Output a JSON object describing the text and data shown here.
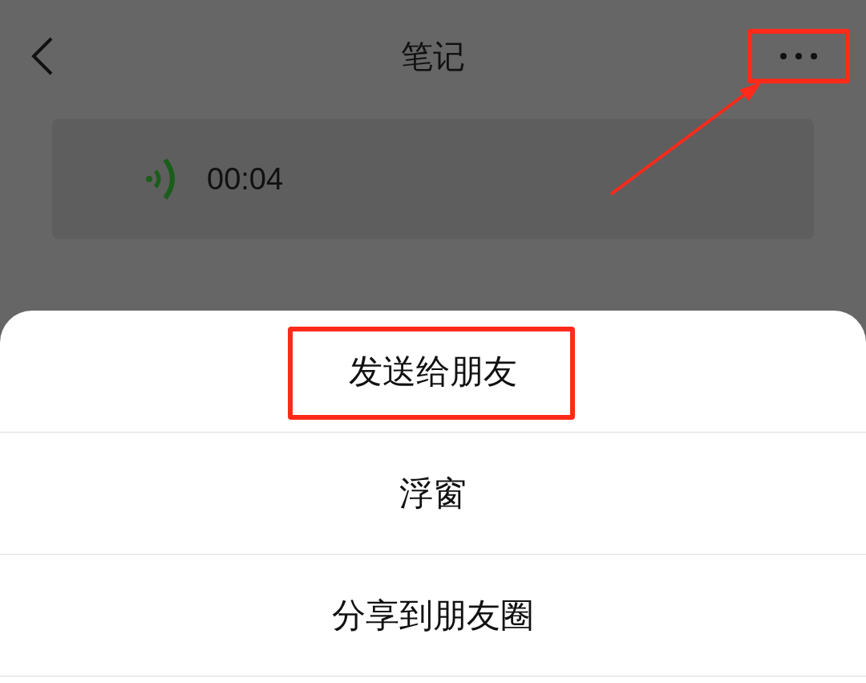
{
  "header": {
    "title": "笔记",
    "more_highlighted": true
  },
  "voice_note": {
    "duration": "00:04"
  },
  "menu": {
    "items": [
      {
        "label": "发送给朋友",
        "highlighted": true
      },
      {
        "label": "浮窗",
        "highlighted": false
      },
      {
        "label": "分享到朋友圈",
        "highlighted": false
      }
    ]
  }
}
